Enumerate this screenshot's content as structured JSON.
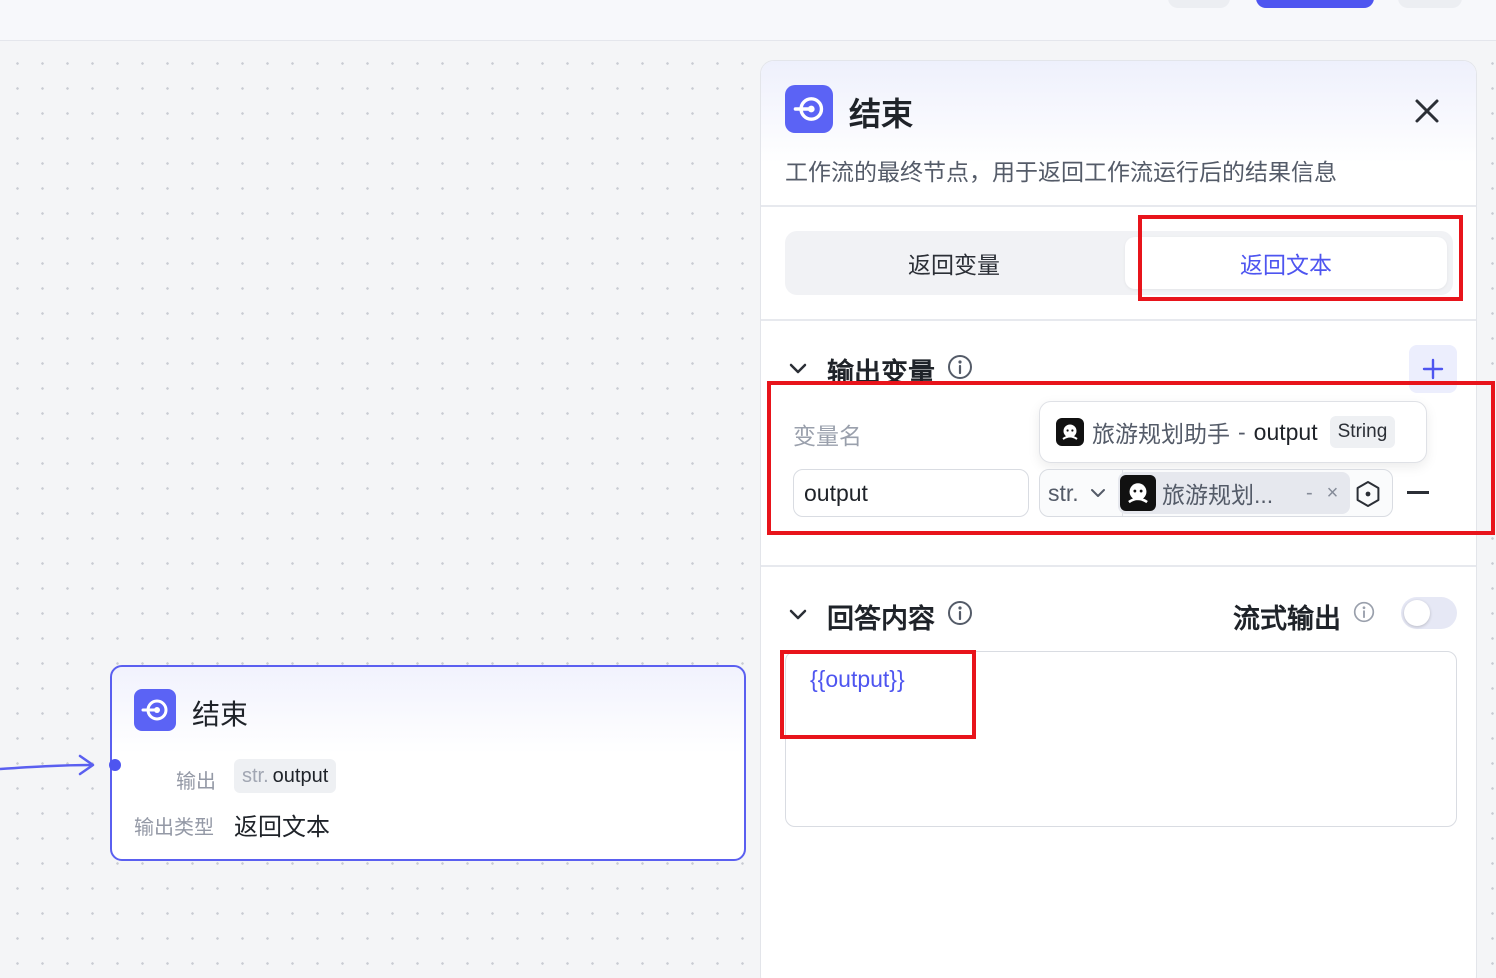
{
  "panel": {
    "title": "结束",
    "description": "工作流的最终节点，用于返回工作流运行后的结果信息",
    "tabs": [
      {
        "label": "返回变量",
        "active": false
      },
      {
        "label": "返回文本",
        "active": true
      }
    ],
    "output_section": {
      "title": "输出变量",
      "variable_name_label": "变量名",
      "rows": [
        {
          "name": "output",
          "type": "str.",
          "reference_label": "旅游规划...",
          "dash": "-",
          "remove_glyph": "×"
        }
      ],
      "tooltip": {
        "source": "旅游规划助手",
        "separator": "-",
        "variable": "output",
        "type": "String"
      }
    },
    "answer_section": {
      "title": "回答内容",
      "stream_label": "流式输出",
      "stream_enabled": false,
      "content": "{{output}}"
    }
  },
  "node": {
    "title": "结束",
    "output_label": "输出",
    "output_type": "str.",
    "output_name": "output",
    "output_kind_label": "输出类型",
    "output_kind_value": "返回文本"
  },
  "colors": {
    "accent": "#4e55f0",
    "annotation": "#e8141b"
  }
}
